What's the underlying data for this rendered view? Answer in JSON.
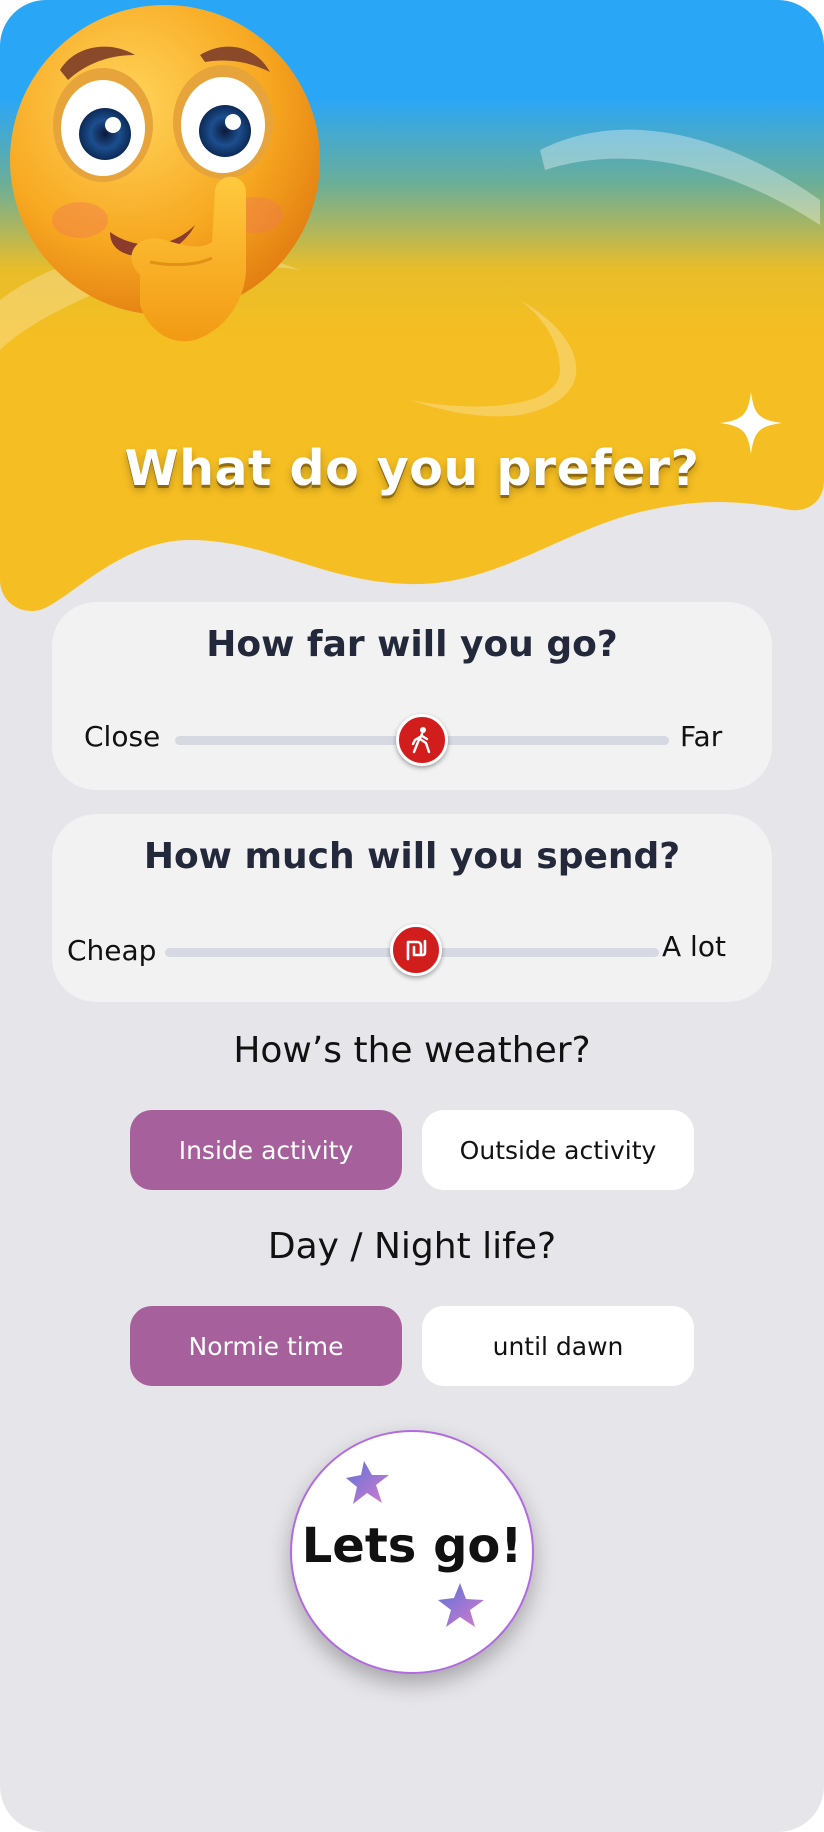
{
  "header": {
    "title": "What do you prefer?"
  },
  "distance": {
    "question": "How far will you go?",
    "min_label": "Close",
    "max_label": "Far",
    "value_percent": 50
  },
  "budget": {
    "question": "How much will you spend?",
    "min_label": "Cheap",
    "max_label": "A lot",
    "value_percent": 50
  },
  "weather": {
    "question": "How’s the weather?",
    "options": [
      "Inside activity",
      "Outside activity"
    ],
    "selected": "Inside activity"
  },
  "daynight": {
    "question": "Day / Night life?",
    "options": [
      "Normie time",
      "until dawn"
    ],
    "selected": "Normie time"
  },
  "go_button": {
    "label": "Lets go!"
  },
  "colors": {
    "sky_top": "#2aa6f7",
    "header_yellow": "#f5be22",
    "background": "#e6e5e9",
    "card": "#f2f2f3",
    "thumb_red": "#d21d1d",
    "selected_purple": "#a6609b"
  }
}
